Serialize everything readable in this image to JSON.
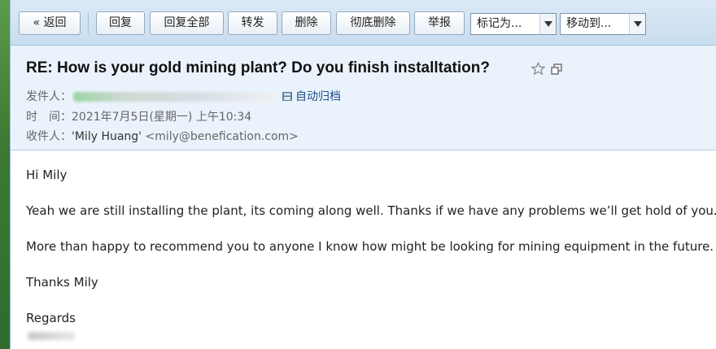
{
  "toolbar": {
    "back_label": "« 返回",
    "reply_label": "回复",
    "reply_all_label": "回复全部",
    "forward_label": "转发",
    "delete_label": "删除",
    "delete_permanent_label": "彻底删除",
    "report_label": "举报",
    "mark_as_selected": "标记为...",
    "move_to_selected": "移动到..."
  },
  "header": {
    "subject": "RE: How is your gold mining plant? Do you finish installtation?",
    "from_label": "发件人：",
    "archive_label": "自动归档",
    "time_label": "时　间：",
    "time_value": "2021年7月5日(星期一) 上午10:34",
    "to_label": "收件人：",
    "to_name": "'Mily Huang'",
    "to_email": "<mily@benefication.com>"
  },
  "body": {
    "greeting": "Hi Mily",
    "para1": "Yeah we are still installing the plant, its coming along well. Thanks if we have any problems we’ll get hold of you.",
    "para2": "More than happy to recommend you to anyone I know how might be looking for mining equipment in the future.",
    "thanks": "Thanks Mily",
    "regards": "Regards"
  },
  "colors": {
    "toolbar_bg": "#d3e4f3",
    "header_bg": "#eaf3fb",
    "link": "#1f4e8c"
  }
}
